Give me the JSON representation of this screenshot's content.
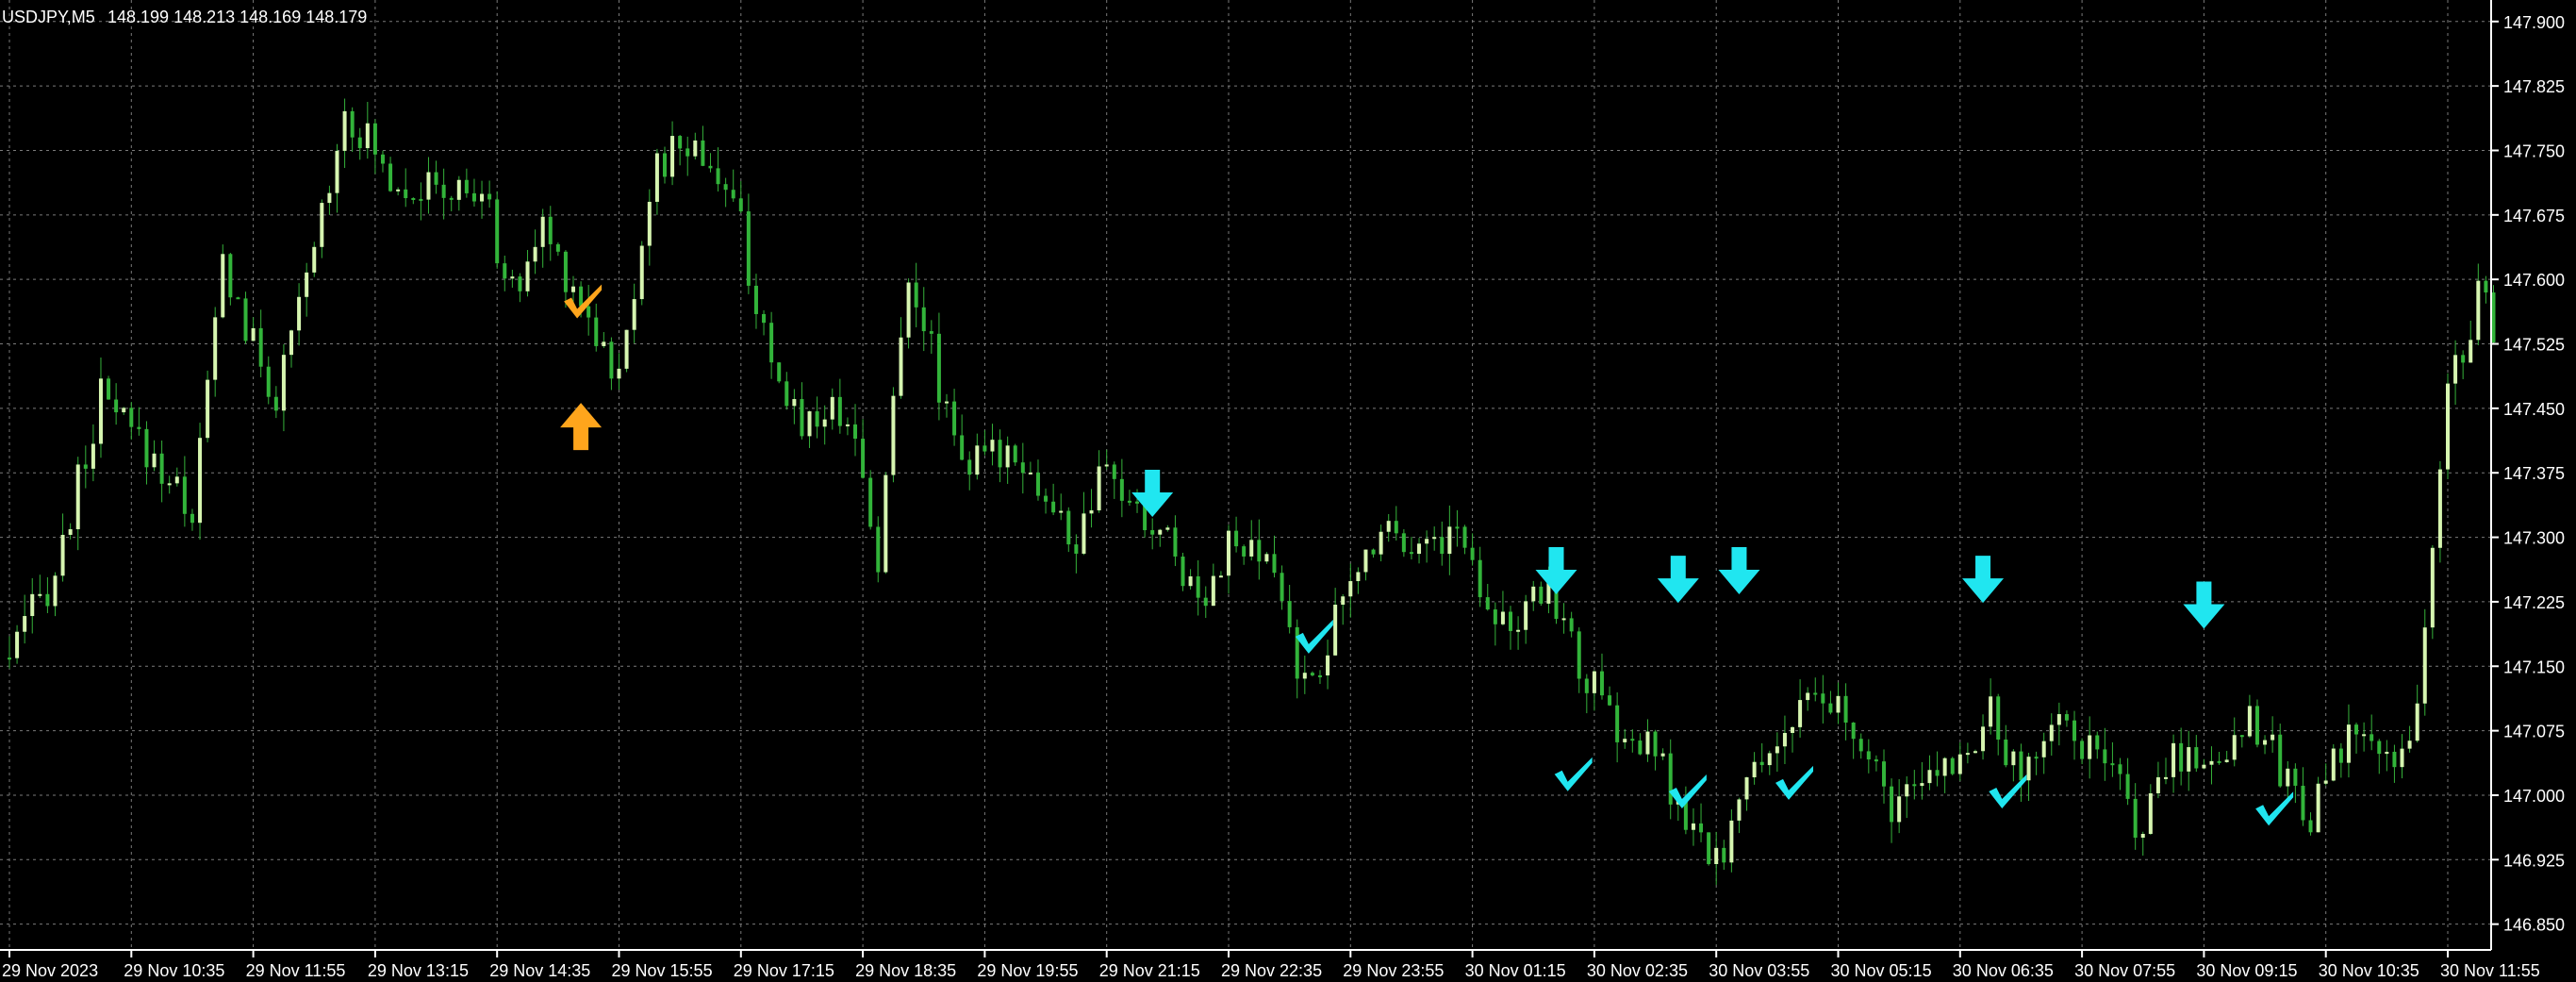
{
  "header": {
    "symbol": "USDJPY,M5",
    "ohlc": "148.199 148.213 148.169 148.179"
  },
  "colors": {
    "background": "#000000",
    "grid": "#7a7a7a",
    "axis": "#ffffff",
    "text": "#ffffff",
    "candle_bull": "#d6f5b0",
    "candle_bear": "#32b43a",
    "wick": "#35b13a",
    "sell_signal": "#20e6f0",
    "buy_signal": "#ffa51c"
  },
  "chart_data": {
    "type": "candlestick",
    "symbol": "USDJPY",
    "timeframe": "M5",
    "ylim": [
      146.82,
      147.925
    ],
    "yticks": [
      "147.900",
      "147.825",
      "147.750",
      "147.675",
      "147.600",
      "147.525",
      "147.450",
      "147.375",
      "147.300",
      "147.225",
      "147.150",
      "147.075",
      "147.000",
      "146.925",
      "146.850"
    ],
    "xticks": [
      "29 Nov 2023",
      "29 Nov 10:35",
      "29 Nov 11:55",
      "29 Nov 13:15",
      "29 Nov 14:35",
      "29 Nov 15:55",
      "29 Nov 17:15",
      "29 Nov 18:35",
      "29 Nov 19:55",
      "29 Nov 21:15",
      "29 Nov 22:35",
      "29 Nov 23:55",
      "30 Nov 01:15",
      "30 Nov 02:35",
      "30 Nov 03:55",
      "30 Nov 05:15",
      "30 Nov 06:35",
      "30 Nov 07:55",
      "30 Nov 09:15",
      "30 Nov 10:35",
      "30 Nov 11:55"
    ],
    "candles_per_tick": 16,
    "total_candles": 327,
    "grid": true,
    "close_path": [
      [
        0,
        147.16
      ],
      [
        6,
        147.26
      ],
      [
        12,
        147.46
      ],
      [
        20,
        147.38
      ],
      [
        24,
        147.33
      ],
      [
        28,
        147.62
      ],
      [
        32,
        147.52
      ],
      [
        35,
        147.46
      ],
      [
        38,
        147.56
      ],
      [
        44,
        147.8
      ],
      [
        50,
        147.72
      ],
      [
        56,
        147.7
      ],
      [
        62,
        147.7
      ],
      [
        66,
        147.58
      ],
      [
        70,
        147.66
      ],
      [
        76,
        147.56
      ],
      [
        80,
        147.48
      ],
      [
        84,
        147.71
      ],
      [
        88,
        147.76
      ],
      [
        92,
        147.74
      ],
      [
        96,
        147.66
      ],
      [
        100,
        147.48
      ],
      [
        104,
        147.44
      ],
      [
        110,
        147.45
      ],
      [
        114,
        147.28
      ],
      [
        118,
        147.62
      ],
      [
        122,
        147.48
      ],
      [
        126,
        147.38
      ],
      [
        132,
        147.41
      ],
      [
        136,
        147.34
      ],
      [
        140,
        147.29
      ],
      [
        144,
        147.38
      ],
      [
        148,
        147.32
      ],
      [
        152,
        147.3
      ],
      [
        156,
        147.23
      ],
      [
        160,
        147.29
      ],
      [
        166,
        147.26
      ],
      [
        170,
        147.12
      ],
      [
        174,
        147.2
      ],
      [
        180,
        147.32
      ],
      [
        186,
        147.29
      ],
      [
        190,
        147.31
      ],
      [
        194,
        147.23
      ],
      [
        198,
        147.19
      ],
      [
        202,
        147.25
      ],
      [
        206,
        147.15
      ],
      [
        212,
        147.06
      ],
      [
        216,
        147.05
      ],
      [
        220,
        146.96
      ],
      [
        224,
        146.92
      ],
      [
        228,
        147.01
      ],
      [
        232,
        147.07
      ],
      [
        236,
        147.1
      ],
      [
        240,
        147.1
      ],
      [
        244,
        147.03
      ],
      [
        248,
        146.98
      ],
      [
        252,
        147.02
      ],
      [
        256,
        147.05
      ],
      [
        260,
        147.09
      ],
      [
        264,
        147.01
      ],
      [
        268,
        147.1
      ],
      [
        272,
        147.06
      ],
      [
        276,
        147.02
      ],
      [
        280,
        146.96
      ],
      [
        284,
        147.05
      ],
      [
        290,
        147.04
      ],
      [
        294,
        147.1
      ],
      [
        298,
        147.03
      ],
      [
        302,
        146.98
      ],
      [
        308,
        147.08
      ],
      [
        312,
        147.03
      ],
      [
        316,
        147.1
      ],
      [
        320,
        147.47
      ],
      [
        324,
        147.58
      ],
      [
        327,
        147.53
      ]
    ],
    "signals": [
      {
        "type": "buy",
        "candle": 75,
        "price": 147.43
      },
      {
        "type": "sell",
        "candle": 150,
        "price": 147.35
      },
      {
        "type": "sell",
        "candle": 203,
        "price": 147.26
      },
      {
        "type": "sell",
        "candle": 219,
        "price": 147.25
      },
      {
        "type": "sell",
        "candle": 227,
        "price": 147.26
      },
      {
        "type": "sell",
        "candle": 259,
        "price": 147.25
      },
      {
        "type": "sell",
        "candle": 288,
        "price": 147.22
      }
    ],
    "checkmarks": [
      {
        "type": "buy",
        "candle": 75,
        "price": 147.57
      },
      {
        "type": "sell",
        "candle": 171,
        "price": 147.18
      },
      {
        "type": "sell",
        "candle": 205,
        "price": 147.02
      },
      {
        "type": "sell",
        "candle": 220,
        "price": 147.0
      },
      {
        "type": "sell",
        "candle": 234,
        "price": 147.01
      },
      {
        "type": "sell",
        "candle": 262,
        "price": 147.0
      },
      {
        "type": "sell",
        "candle": 297,
        "price": 146.98
      }
    ]
  }
}
